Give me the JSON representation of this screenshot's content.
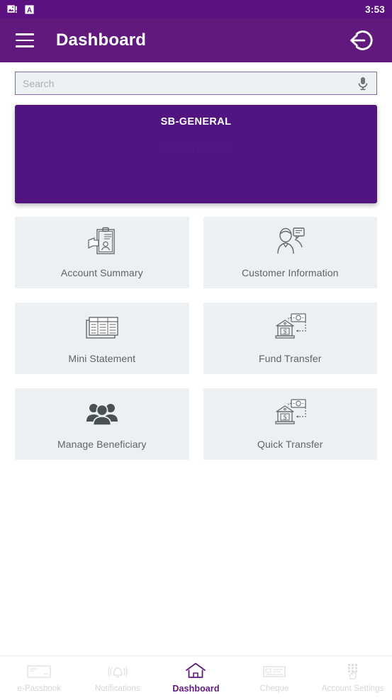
{
  "status_bar": {
    "time": "3:53",
    "icons": [
      {
        "name": "image-alert-icon"
      },
      {
        "name": "letter-a-icon"
      }
    ]
  },
  "app_bar": {
    "menu_icon": "hamburger-menu-icon",
    "title": "Dashboard",
    "logout_icon": "logout-icon"
  },
  "search": {
    "placeholder": "Search",
    "value": "",
    "mic_icon": "microphone-icon"
  },
  "account_card": {
    "title": "SB-GENERAL",
    "subtitle": "XXXXXXXXXXXX"
  },
  "tiles": [
    {
      "label": "Account Summary",
      "icon": "clipboard-person-icon"
    },
    {
      "label": "Customer Information",
      "icon": "person-speech-bubble-icon"
    },
    {
      "label": "Mini Statement",
      "icon": "statement-table-icon"
    },
    {
      "label": "Fund Transfer",
      "icon": "bank-transfer-icon"
    },
    {
      "label": "Manage Beneficiary",
      "icon": "people-group-icon"
    },
    {
      "label": "Quick Transfer",
      "icon": "bank-transfer-icon"
    }
  ],
  "bottom_nav": {
    "items": [
      {
        "label": "e-Passbook",
        "icon": "passbook-icon",
        "active": false
      },
      {
        "label": "Notifications",
        "icon": "bell-icon",
        "active": false
      },
      {
        "label": "Dashboard",
        "icon": "home-icon",
        "active": true
      },
      {
        "label": "Cheque",
        "icon": "cheque-icon",
        "active": false
      },
      {
        "label": "Account Settings",
        "icon": "keypad-hand-icon",
        "active": false
      }
    ]
  },
  "colors": {
    "status_bar": "#5b1180",
    "app_bar": "#62197e",
    "card": "#511481",
    "tile_bg": "#edf0f3",
    "accent": "#62197e",
    "nav_inactive": "#d3d6da"
  }
}
